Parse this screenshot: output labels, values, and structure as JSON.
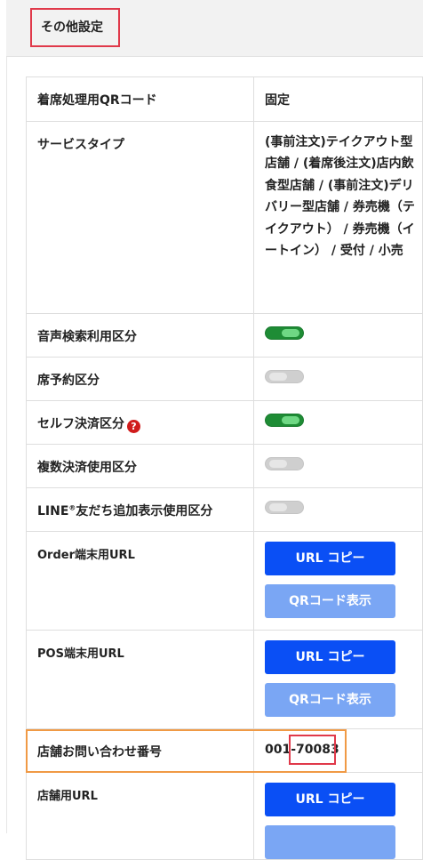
{
  "section": {
    "title": "その他設定"
  },
  "rows": {
    "qr_seat": {
      "label": "着席処理用QRコード",
      "value": "固定"
    },
    "service_type": {
      "label": "サービスタイプ",
      "value": "(事前注文)テイクアウト型店舗 / (着席後注文)店内飲食型店舗 / (事前注文)デリバリー型店舗 / 券売機（テイクアウト） / 券売機（イートイン） / 受付 / 小売"
    },
    "voice_search": {
      "label": "音声検索利用区分",
      "toggle": "on"
    },
    "seat_reservation": {
      "label": "席予約区分",
      "toggle": "off"
    },
    "self_checkout": {
      "label": "セルフ決済区分",
      "help_icon": "question-circle-icon",
      "toggle": "on"
    },
    "multi_payment": {
      "label": "複数決済使用区分",
      "toggle": "off"
    },
    "line_friend": {
      "label_main": "LINE",
      "label_mark": "®",
      "label_rest": "友だち追加表示使用区分",
      "toggle": "off"
    },
    "order_url": {
      "label": "Order端末用URL",
      "copy_button": "URL コピー",
      "qr_button": "QRコード表示"
    },
    "pos_url": {
      "label": "POS端末用URL",
      "copy_button": "URL コピー",
      "qr_button": "QRコード表示"
    },
    "contact": {
      "label": "店舗お問い合わせ番号",
      "value_prefix": "001-",
      "value_number": "70083"
    },
    "store_url": {
      "label": "店舗用URL",
      "copy_button": "URL コピー"
    }
  },
  "colors": {
    "toggle_on": "#1e8c35",
    "toggle_off": "#cfcfcf",
    "primary_button": "#0a4ff5",
    "secondary_button": "#7aa6f4",
    "highlight_red": "#e0394a",
    "highlight_orange": "#f09a45"
  }
}
